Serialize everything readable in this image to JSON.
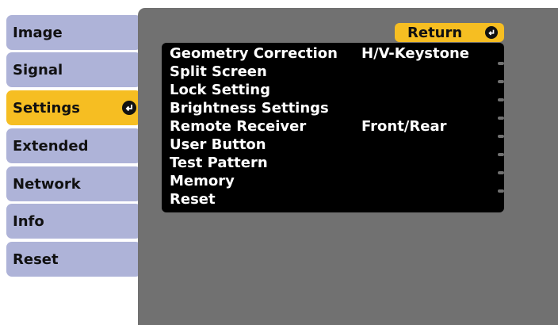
{
  "tabs": [
    {
      "label": "Image",
      "selected": false
    },
    {
      "label": "Signal",
      "selected": false
    },
    {
      "label": "Settings",
      "selected": true
    },
    {
      "label": "Extended",
      "selected": false
    },
    {
      "label": "Network",
      "selected": false
    },
    {
      "label": "Info",
      "selected": false
    },
    {
      "label": "Reset",
      "selected": false
    }
  ],
  "return_button": {
    "label": "Return",
    "icon": "enter-icon"
  },
  "menu_items": [
    {
      "label": "Geometry Correction",
      "value": "H/V-Keystone"
    },
    {
      "label": "Split Screen",
      "value": ""
    },
    {
      "label": "Lock Setting",
      "value": ""
    },
    {
      "label": "Brightness Settings",
      "value": ""
    },
    {
      "label": "Remote Receiver",
      "value": "Front/Rear"
    },
    {
      "label": "User Button",
      "value": ""
    },
    {
      "label": "Test Pattern",
      "value": ""
    },
    {
      "label": "Memory",
      "value": ""
    },
    {
      "label": "Reset",
      "value": ""
    }
  ],
  "colors": {
    "tab_bg": "#aeb3d8",
    "tab_selected_bg": "#f6be22",
    "panel_bg": "#717171",
    "menu_bg": "#000000",
    "return_bg": "#f6be22"
  }
}
